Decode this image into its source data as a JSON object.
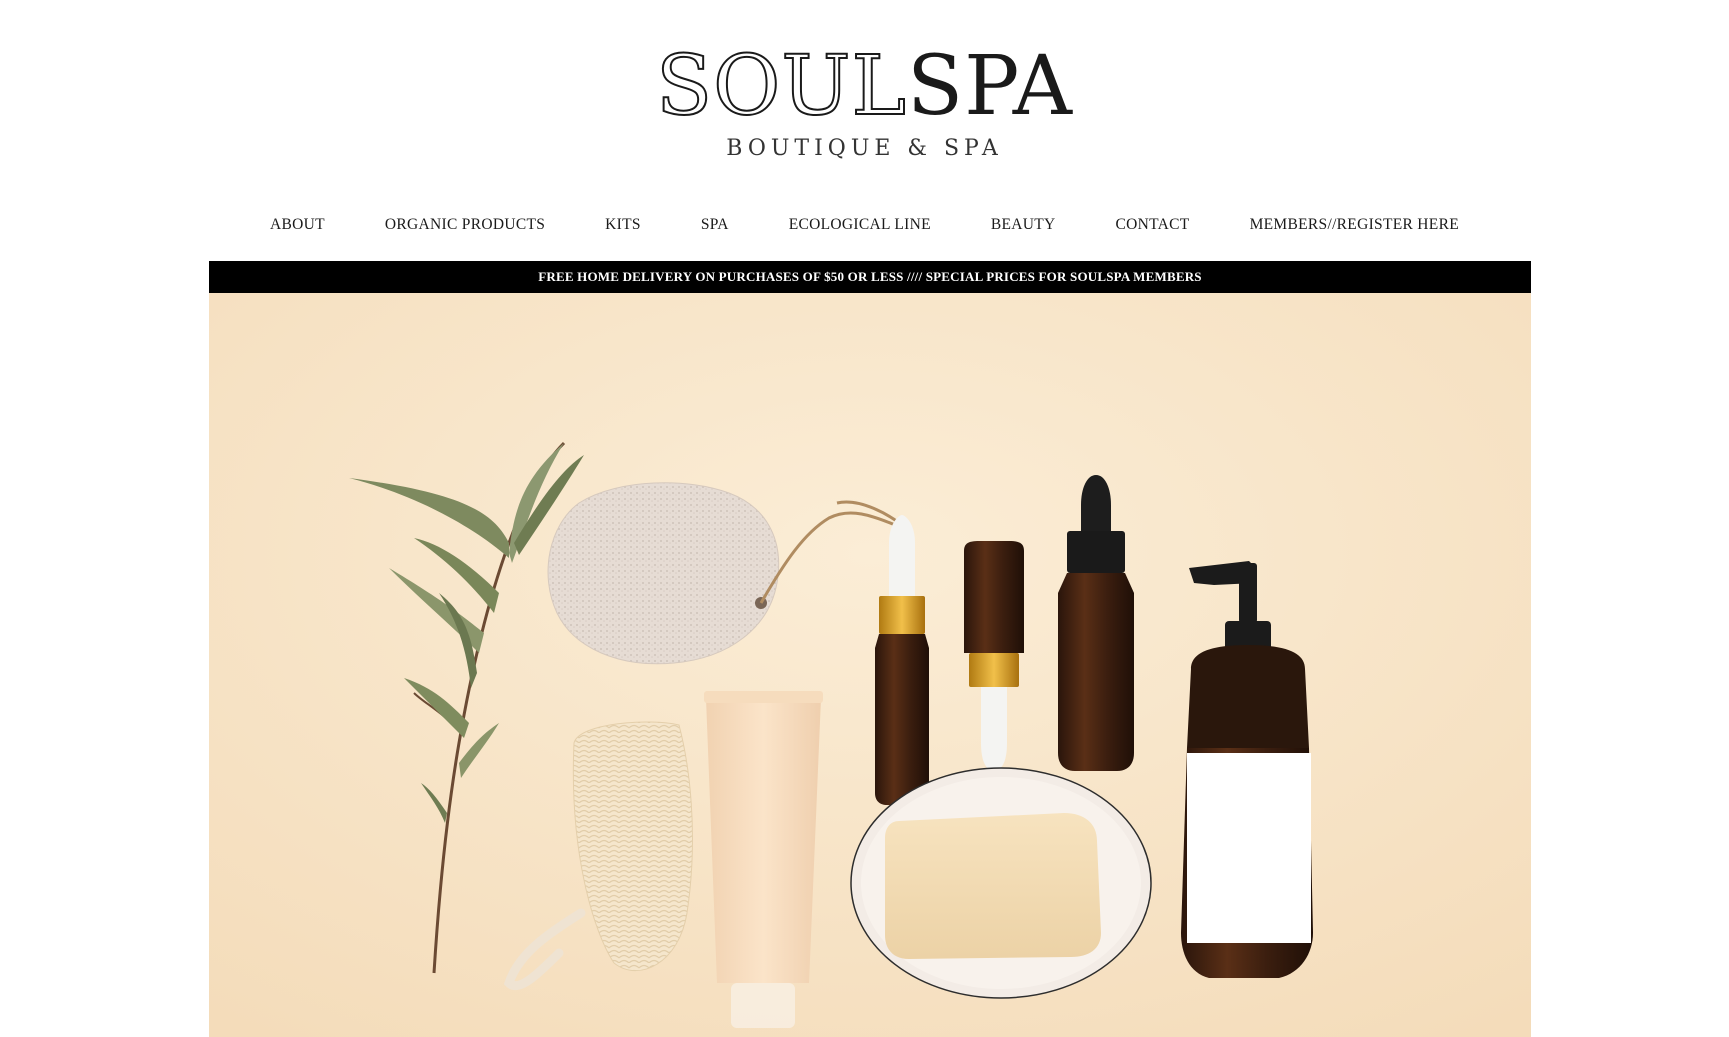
{
  "brand": {
    "logo_outline": "SOUL",
    "logo_solid": "SPA",
    "tagline": "BOUTIQUE & SPA"
  },
  "nav": {
    "items": [
      {
        "label": "ABOUT"
      },
      {
        "label": "ORGANIC PRODUCTS"
      },
      {
        "label": "KITS"
      },
      {
        "label": "SPA"
      },
      {
        "label": "ECOLOGICAL LINE"
      },
      {
        "label": "BEAUTY"
      },
      {
        "label": "CONTACT"
      },
      {
        "label": "MEMBERS//REGISTER HERE"
      }
    ]
  },
  "announcement": {
    "text": "FREE HOME DELIVERY ON PURCHASES OF $50 OR LESS //// SPECIAL PRICES FOR SOULSPA MEMBERS"
  },
  "hero": {
    "image_subject": "spa-products-flatlay",
    "colors": {
      "background": "#f8e6cb",
      "amber_glass": "#3a1f12",
      "gold_collar": "#d39a1f",
      "pump_black": "#1b1b1b"
    }
  }
}
